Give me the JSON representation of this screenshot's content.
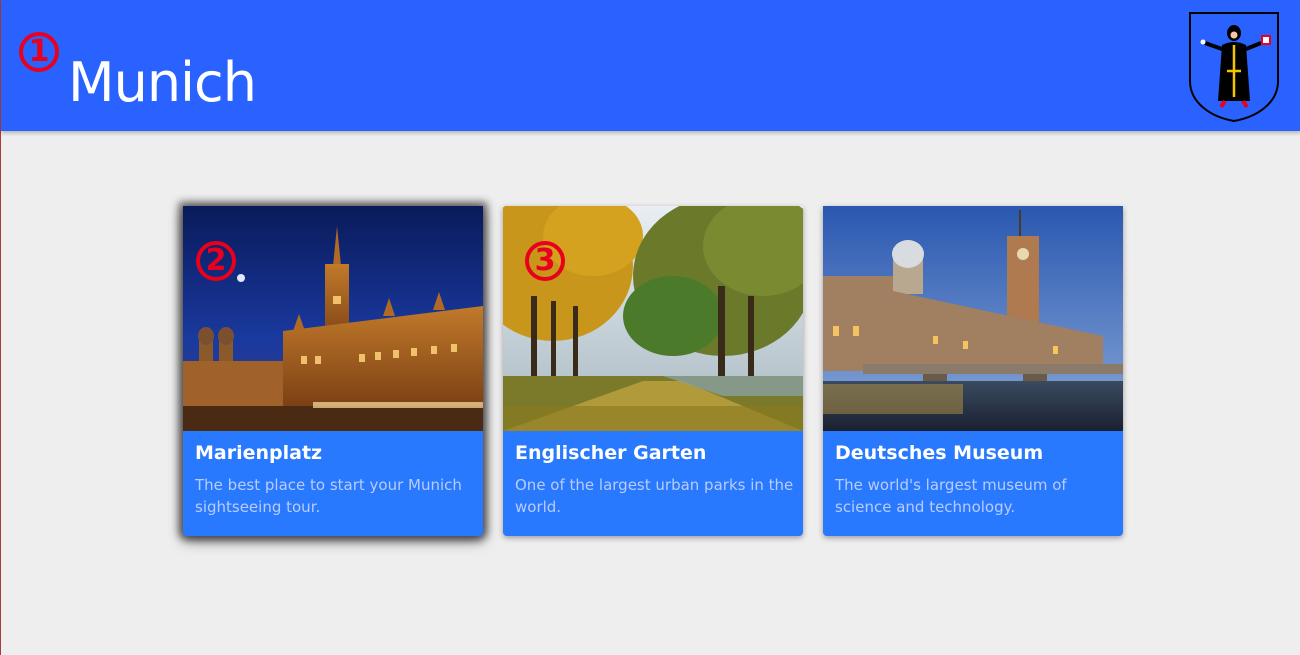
{
  "header": {
    "title": "Munich",
    "background_color": "#2962ff",
    "logo_icon": "munich-coat-of-arms-icon"
  },
  "markers": [
    "1",
    "2",
    "3"
  ],
  "cards": [
    {
      "title": "Marienplatz",
      "description": "The best place to start your Munich sightseeing tour.",
      "image_icon": "marienplatz-photo",
      "focused": true
    },
    {
      "title": "Englischer Garten",
      "description": "One of the largest urban parks in the world.",
      "image_icon": "englischer-garten-photo",
      "focused": false
    },
    {
      "title": "Deutsches Museum",
      "description": "The world's largest museum of science and technology.",
      "image_icon": "deutsches-museum-photo",
      "focused": false
    }
  ],
  "colors": {
    "card_background": "#2979ff",
    "card_description": "#b9ccff",
    "page_background": "#eeeeee",
    "marker": "#e8001c"
  }
}
